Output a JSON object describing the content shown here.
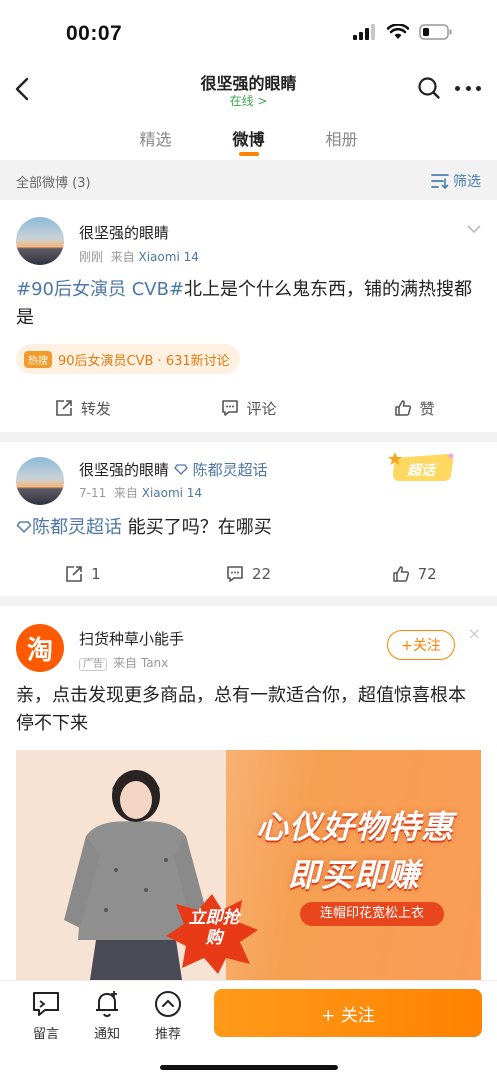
{
  "status_bar": {
    "time": "00:07"
  },
  "header": {
    "title": "很坚强的眼睛",
    "status": "在线 >"
  },
  "tabs": [
    {
      "label": "精选",
      "active": false
    },
    {
      "label": "微博",
      "active": true
    },
    {
      "label": "相册",
      "active": false
    }
  ],
  "filter": {
    "left_label": "全部微博 (3)",
    "right_label": "筛选"
  },
  "posts": [
    {
      "author": "很坚强的眼睛",
      "time": "刚刚",
      "source_prefix": "来自",
      "source": "Xiaomi 14",
      "hashtag": "#90后女演员 CVB#",
      "text": "北上是个什么鬼东西，铺的满热搜都是",
      "hot_badge": "热搜",
      "hot_text": "90后女演员CVB · 631新讨论",
      "repost_label": "转发",
      "comment_label": "评论",
      "like_label": "赞"
    },
    {
      "author": "很坚强的眼睛",
      "super_topic": "陈都灵超话",
      "time": "7-11",
      "source_prefix": "来自",
      "source": "Xiaomi 14",
      "topic_link": "陈都灵超话",
      "text": " 能买了吗？在哪买",
      "badge": "超话",
      "reposts": "1",
      "comments": "22",
      "likes": "72"
    }
  ],
  "ad": {
    "author": "扫货种草小能手",
    "logo_char": "淘",
    "ad_tag": "广告",
    "source_prefix": "来自",
    "source": "Tanx",
    "follow_label": "+关注",
    "close": "×",
    "text": "亲，点击发现更多商品，总有一款适合你，超值惊喜根本停不下来",
    "banner_line1": "心仪好物特惠",
    "banner_line2": "即买即赚",
    "banner_sub": "连帽印花宽松上衣",
    "banner_burst": "立即抢购"
  },
  "bottom_bar": {
    "message_label": "留言",
    "notify_label": "通知",
    "recommend_label": "推荐",
    "follow_label": "+ 关注"
  },
  "colors": {
    "accent": "#ff8200",
    "link": "#4d77a6",
    "online": "#3aa84b"
  }
}
